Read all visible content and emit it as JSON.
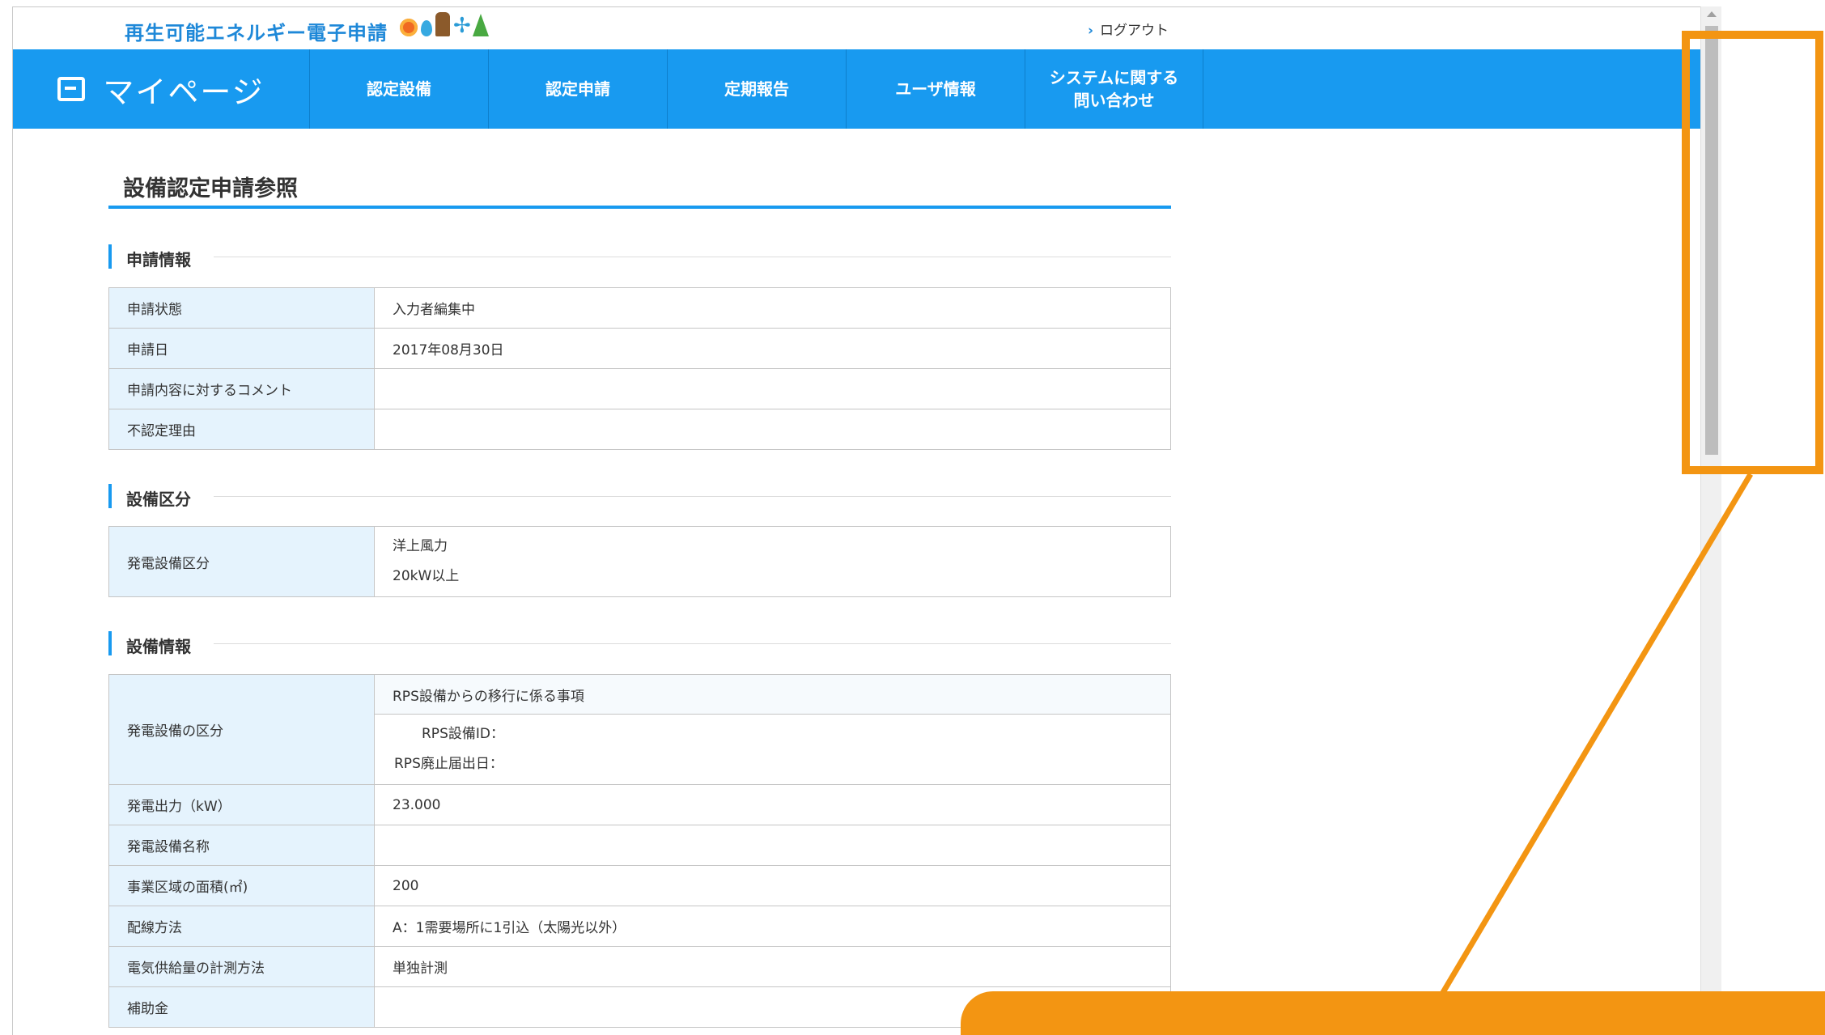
{
  "header": {
    "brand": "再生可能エネルギー電子申請",
    "logout": "ログアウト"
  },
  "nav": {
    "home": "マイページ",
    "items": [
      "認定設備",
      "認定申請",
      "定期報告",
      "ユーザ情報"
    ],
    "inquiry_line1": "システムに関する",
    "inquiry_line2": "問い合わせ"
  },
  "page": {
    "title": "設備認定申請参照"
  },
  "application_info": {
    "heading": "申請情報",
    "rows": [
      {
        "key": "申請状態",
        "value": "入力者編集中"
      },
      {
        "key": "申請日",
        "value": "2017年08月30日"
      },
      {
        "key": "申請内容に対するコメント",
        "value": ""
      },
      {
        "key": "不認定理由",
        "value": ""
      }
    ]
  },
  "facility_class": {
    "heading": "設備区分",
    "key": "発電設備区分",
    "value_line1": "洋上風力",
    "value_line2": "20kW以上"
  },
  "facility_info": {
    "heading": "設備情報",
    "category_key": "発電設備の区分",
    "category_title": "RPS設備からの移行に係る事項",
    "rps_id_label": "RPS設備ID：",
    "rps_abolish_label": "RPS廃止届出日：",
    "rows": [
      {
        "key": "発電出力（kW）",
        "value": "23.000"
      },
      {
        "key": "発電設備名称",
        "value": ""
      },
      {
        "key": "事業区域の面積(㎡)",
        "value": "200"
      },
      {
        "key": "配線方法",
        "value": "A：1需要場所に1引込（太陽光以外）"
      },
      {
        "key": "電気供給量の計測方法",
        "value": "単独計測"
      },
      {
        "key": "補助金",
        "value": ""
      }
    ]
  },
  "colors": {
    "nav_blue": "#189af0",
    "key_cell": "#e5f3fd",
    "annotation_orange": "#f39512"
  }
}
